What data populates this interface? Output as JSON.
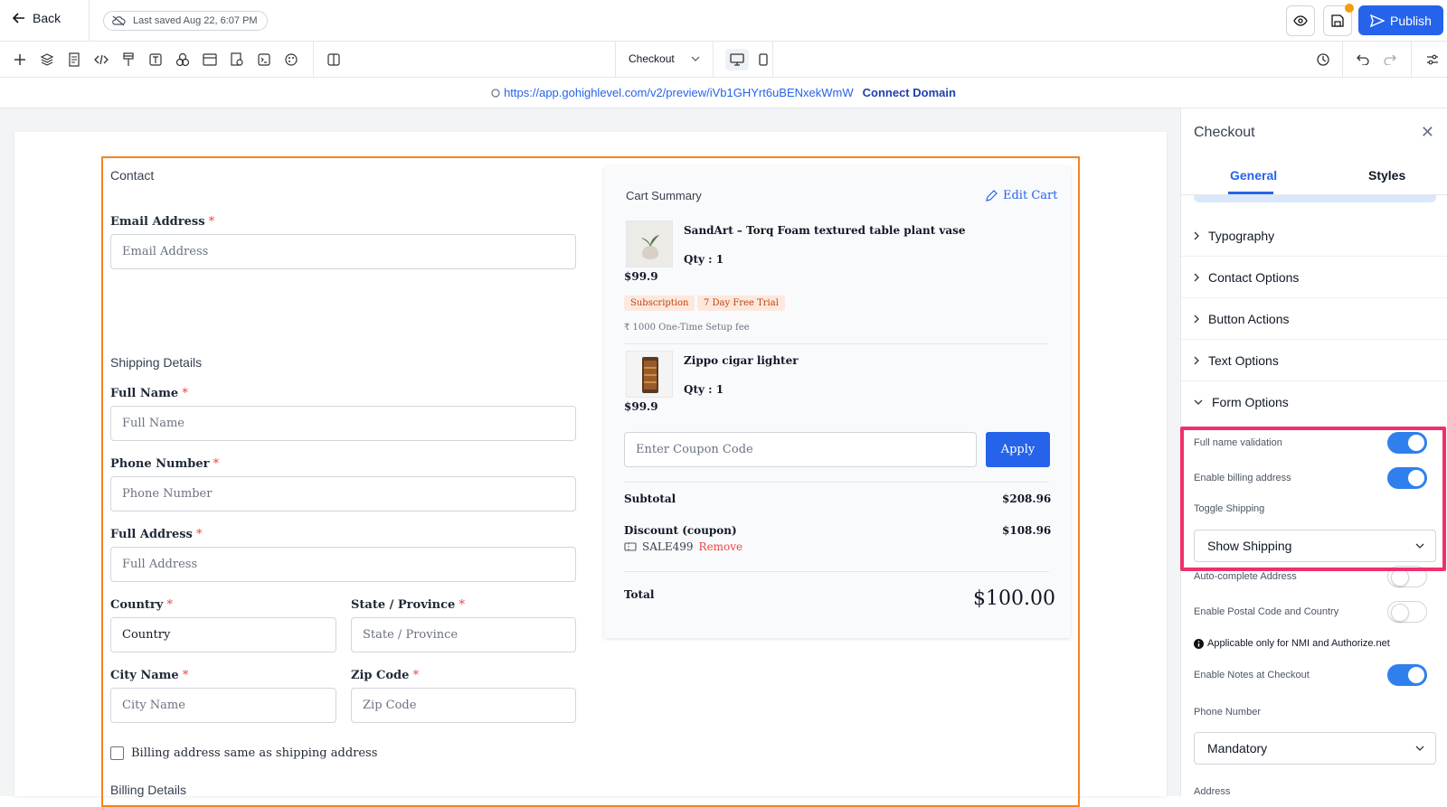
{
  "topbar": {
    "back_label": "Back",
    "saved_text": "Last saved Aug 22, 6:07 PM",
    "publish_label": "Publish"
  },
  "toolbar": {
    "page_select": "Checkout"
  },
  "urlbar": {
    "url": "https://app.gohighlevel.com/v2/preview/iVb1GHYrt6uBENxekWmW",
    "connect_label": "Connect Domain"
  },
  "form": {
    "contact_title": "Contact",
    "email_label": "Email Address",
    "email_placeholder": "Email Address",
    "shipping_title": "Shipping Details",
    "fullname_label": "Full Name",
    "fullname_placeholder": "Full Name",
    "phone_label": "Phone Number",
    "phone_placeholder": "Phone Number",
    "address_label": "Full Address",
    "address_placeholder": "Full Address",
    "country_label": "Country",
    "country_placeholder": "Country",
    "state_label": "State / Province",
    "state_placeholder": "State / Province",
    "city_label": "City Name",
    "city_placeholder": "City Name",
    "zip_label": "Zip Code",
    "zip_placeholder": "Zip Code",
    "billing_same_label": "Billing address same as shipping address",
    "billing_title": "Billing Details",
    "required_mark": "*"
  },
  "cart": {
    "title": "Cart Summary",
    "edit_label": "Edit Cart",
    "items": [
      {
        "name": "SandArt – Torq Foam textured table plant vase",
        "qty": "Qty : 1",
        "price": "$99.9"
      },
      {
        "name": "Zippo cigar lighter",
        "qty": "Qty : 1",
        "price": "$99.9"
      }
    ],
    "badge_subscription": "Subscription",
    "badge_trial": "7 Day Free Trial",
    "setup_fee": "₹ 1000 One-Time Setup fee",
    "coupon_placeholder": "Enter Coupon Code",
    "apply_label": "Apply",
    "subtotal_label": "Subtotal",
    "subtotal_value": "$208.96",
    "discount_label": "Discount (coupon)",
    "discount_value": "$108.96",
    "coupon_code": "SALE499",
    "remove_label": "Remove",
    "total_label": "Total",
    "total_value": "$100.00"
  },
  "panel": {
    "title": "Checkout",
    "tabs": [
      "General",
      "Styles"
    ],
    "sections": [
      "Typography",
      "Contact Options",
      "Button Actions",
      "Text Options",
      "Form Options"
    ],
    "options": {
      "full_name_validation": "Full name validation",
      "enable_billing": "Enable billing address",
      "toggle_shipping": "Toggle Shipping",
      "shipping_value": "Show Shipping",
      "autocomplete": "Auto-complete Address",
      "postal_country": "Enable Postal Code and Country",
      "nmi_note": "Applicable only for NMI and Authorize.net",
      "notes": "Enable Notes at Checkout",
      "phone_label": "Phone Number",
      "phone_value": "Mandatory",
      "address_label": "Address"
    },
    "toggle_states": {
      "full_name_validation": true,
      "enable_billing": true,
      "autocomplete": false,
      "postal_country": false,
      "notes": true
    }
  },
  "colors": {
    "accent": "#2563eb",
    "selection_border": "#f58220",
    "highlight": "#f0306a",
    "badge_text": "#c2410c"
  }
}
